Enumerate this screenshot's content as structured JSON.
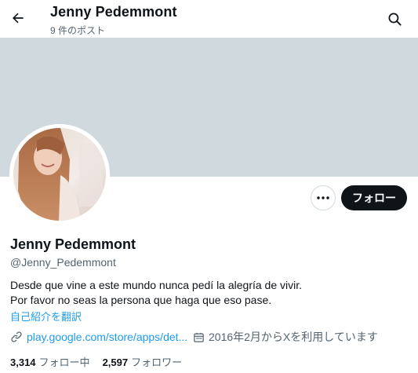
{
  "header": {
    "title": "Jenny Pedemmont",
    "post_count": "9 件のポスト"
  },
  "icons": {
    "back": "arrow-left-icon",
    "search": "search-icon",
    "more": "ellipsis-icon",
    "link": "link-icon",
    "calendar": "calendar-icon"
  },
  "profile": {
    "name": "Jenny Pedemmont",
    "handle": "@Jenny_Pedemmont",
    "bio_line1": "Desde que vine a este mundo nunca pedí la alegría de vivir.",
    "bio_line2": "Por favor no seas la persona que haga que eso pase.",
    "translate_label": "自己紹介を翻訳",
    "link_text": "play.google.com/store/apps/det...",
    "joined_text": "2016年2月からXを利用しています",
    "following_count": "3,314",
    "following_label": "フォロー中",
    "followers_count": "2,597",
    "followers_label": "フォロワー"
  },
  "actions": {
    "follow_label": "フォロー"
  },
  "colors": {
    "banner": "#cfd9de",
    "link": "#1d9bf0",
    "muted": "#536471",
    "follow_button": "#0f1419"
  }
}
